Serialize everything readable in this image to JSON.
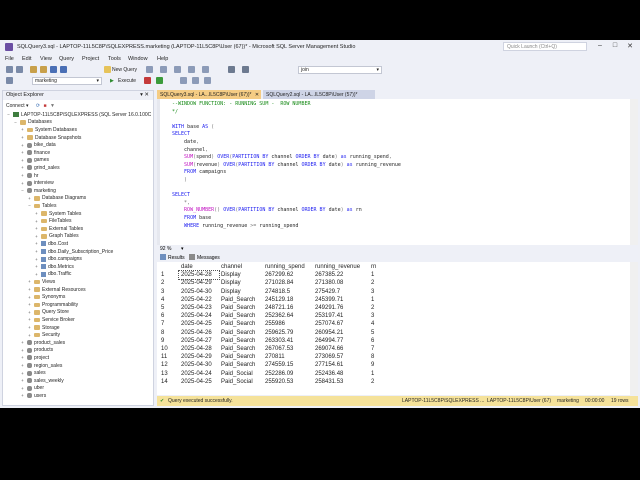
{
  "window": {
    "title": "SQLQuery3.sql - LAPTOP-11L5C8P\\SQLEXPRESS.marketing (LAPTOP-11L5C8P\\User (67))* - Microsoft SQL Server Management Studio",
    "quick_launch_placeholder": "Quick Launch (Ctrl+Q)"
  },
  "menu": [
    "File",
    "Edit",
    "View",
    "Query",
    "Project",
    "Tools",
    "Window",
    "Help"
  ],
  "toolbar": {
    "new_query": "New Query",
    "search_combo": "join",
    "database_combo": "marketing",
    "execute": "Execute"
  },
  "object_explorer": {
    "title": "Object Explorer",
    "connect": "Connect",
    "nodes": [
      {
        "label": "LAPTOP-11L5C8P\\SQLEXPRESS (SQL Server 16.0.100C",
        "level": 0,
        "exp": "−",
        "icon": "server"
      },
      {
        "label": "Databases",
        "level": 1,
        "exp": "−",
        "icon": "folder"
      },
      {
        "label": "System Databases",
        "level": 2,
        "exp": "+",
        "icon": "folder"
      },
      {
        "label": "Database Snapshots",
        "level": 2,
        "exp": "+",
        "icon": "folder"
      },
      {
        "label": "bike_data",
        "level": 2,
        "exp": "+",
        "icon": "db"
      },
      {
        "label": "finance",
        "level": 2,
        "exp": "+",
        "icon": "db"
      },
      {
        "label": "games",
        "level": 2,
        "exp": "+",
        "icon": "db"
      },
      {
        "label": "grind_sales",
        "level": 2,
        "exp": "+",
        "icon": "db"
      },
      {
        "label": "hr",
        "level": 2,
        "exp": "+",
        "icon": "db"
      },
      {
        "label": "interview",
        "level": 2,
        "exp": "+",
        "icon": "db"
      },
      {
        "label": "marketing",
        "level": 2,
        "exp": "−",
        "icon": "db"
      },
      {
        "label": "Database Diagrams",
        "level": 3,
        "exp": "+",
        "icon": "folder"
      },
      {
        "label": "Tables",
        "level": 3,
        "exp": "−",
        "icon": "folder"
      },
      {
        "label": "System Tables",
        "level": 4,
        "exp": "+",
        "icon": "folder"
      },
      {
        "label": "FileTables",
        "level": 4,
        "exp": "+",
        "icon": "folder"
      },
      {
        "label": "External Tables",
        "level": 4,
        "exp": "+",
        "icon": "folder"
      },
      {
        "label": "Graph Tables",
        "level": 4,
        "exp": "+",
        "icon": "folder"
      },
      {
        "label": "dbo.Cost",
        "level": 4,
        "exp": "+",
        "icon": "table"
      },
      {
        "label": "dbo.Daily_Subscription_Price",
        "level": 4,
        "exp": "+",
        "icon": "table"
      },
      {
        "label": "dbo.campaigns",
        "level": 4,
        "exp": "+",
        "icon": "table"
      },
      {
        "label": "dbo.Metrics",
        "level": 4,
        "exp": "+",
        "icon": "table"
      },
      {
        "label": "dbo.Traffic",
        "level": 4,
        "exp": "+",
        "icon": "table"
      },
      {
        "label": "Views",
        "level": 3,
        "exp": "+",
        "icon": "folder"
      },
      {
        "label": "External Resources",
        "level": 3,
        "exp": "+",
        "icon": "folder"
      },
      {
        "label": "Synonyms",
        "level": 3,
        "exp": "+",
        "icon": "folder"
      },
      {
        "label": "Programmability",
        "level": 3,
        "exp": "+",
        "icon": "folder"
      },
      {
        "label": "Query Store",
        "level": 3,
        "exp": "+",
        "icon": "folder"
      },
      {
        "label": "Service Broker",
        "level": 3,
        "exp": "+",
        "icon": "folder"
      },
      {
        "label": "Storage",
        "level": 3,
        "exp": "+",
        "icon": "folder"
      },
      {
        "label": "Security",
        "level": 3,
        "exp": "+",
        "icon": "folder"
      },
      {
        "label": "product_sales",
        "level": 2,
        "exp": "+",
        "icon": "db"
      },
      {
        "label": "products",
        "level": 2,
        "exp": "+",
        "icon": "db"
      },
      {
        "label": "project",
        "level": 2,
        "exp": "+",
        "icon": "db"
      },
      {
        "label": "region_sales",
        "level": 2,
        "exp": "+",
        "icon": "db"
      },
      {
        "label": "sales",
        "level": 2,
        "exp": "+",
        "icon": "db"
      },
      {
        "label": "sales_weekly",
        "level": 2,
        "exp": "+",
        "icon": "db"
      },
      {
        "label": "uber",
        "level": 2,
        "exp": "+",
        "icon": "db"
      },
      {
        "label": "users",
        "level": 2,
        "exp": "+",
        "icon": "db"
      }
    ]
  },
  "tabs": [
    {
      "label": "SQLQuery3.sql - LA...IL5C8P\\User (67))*",
      "active": true
    },
    {
      "label": "SQLQuery2.sql - LA...IL5C8P\\User (57))*",
      "active": false
    }
  ],
  "code_lines": [
    [
      {
        "t": "--WINDOW FUNCTION: - RUNNING SUM -  ROW NUMBER",
        "c": "cm"
      }
    ],
    [
      {
        "t": "*/",
        "c": "cm"
      }
    ],
    [
      {
        "t": "",
        "c": "tx"
      }
    ],
    [
      {
        "t": "WITH ",
        "c": "kw"
      },
      {
        "t": "base ",
        "c": "tx"
      },
      {
        "t": "AS ",
        "c": "kw"
      },
      {
        "t": "(",
        "c": "gr"
      }
    ],
    [
      {
        "t": "SELECT",
        "c": "kw"
      }
    ],
    [
      {
        "t": "    date",
        "c": "tx"
      },
      {
        "t": ",",
        "c": "gr"
      }
    ],
    [
      {
        "t": "    channel",
        "c": "tx"
      },
      {
        "t": ",",
        "c": "gr"
      }
    ],
    [
      {
        "t": "    ",
        "c": "tx"
      },
      {
        "t": "SUM",
        "c": "fn"
      },
      {
        "t": "(",
        "c": "gr"
      },
      {
        "t": "spend",
        "c": "tx"
      },
      {
        "t": ") ",
        "c": "gr"
      },
      {
        "t": "OVER",
        "c": "kw"
      },
      {
        "t": "(",
        "c": "gr"
      },
      {
        "t": "PARTITION BY ",
        "c": "kw"
      },
      {
        "t": "channel ",
        "c": "tx"
      },
      {
        "t": "ORDER BY ",
        "c": "kw"
      },
      {
        "t": "date",
        "c": "tx"
      },
      {
        "t": ") ",
        "c": "gr"
      },
      {
        "t": "as ",
        "c": "kw"
      },
      {
        "t": "running_spend",
        "c": "tx"
      },
      {
        "t": ",",
        "c": "gr"
      }
    ],
    [
      {
        "t": "    ",
        "c": "tx"
      },
      {
        "t": "SUM",
        "c": "fn"
      },
      {
        "t": "(",
        "c": "gr"
      },
      {
        "t": "revenue",
        "c": "tx"
      },
      {
        "t": ") ",
        "c": "gr"
      },
      {
        "t": "OVER",
        "c": "kw"
      },
      {
        "t": "(",
        "c": "gr"
      },
      {
        "t": "PARTITION BY ",
        "c": "kw"
      },
      {
        "t": "channel ",
        "c": "tx"
      },
      {
        "t": "ORDER BY ",
        "c": "kw"
      },
      {
        "t": "date",
        "c": "tx"
      },
      {
        "t": ") ",
        "c": "gr"
      },
      {
        "t": "as ",
        "c": "kw"
      },
      {
        "t": "running_revenue",
        "c": "tx"
      }
    ],
    [
      {
        "t": "    ",
        "c": "tx"
      },
      {
        "t": "FROM ",
        "c": "kw"
      },
      {
        "t": "campaigns",
        "c": "tx"
      }
    ],
    [
      {
        "t": "    )",
        "c": "gr"
      }
    ],
    [
      {
        "t": "",
        "c": "tx"
      }
    ],
    [
      {
        "t": "SELECT",
        "c": "kw"
      }
    ],
    [
      {
        "t": "    *",
        "c": "gr"
      },
      {
        "t": ",",
        "c": "gr"
      }
    ],
    [
      {
        "t": "    ",
        "c": "tx"
      },
      {
        "t": "ROW_NUMBER",
        "c": "fn"
      },
      {
        "t": "() ",
        "c": "gr"
      },
      {
        "t": "OVER",
        "c": "kw"
      },
      {
        "t": "(",
        "c": "gr"
      },
      {
        "t": "PARTITION BY ",
        "c": "kw"
      },
      {
        "t": "channel ",
        "c": "tx"
      },
      {
        "t": "ORDER BY ",
        "c": "kw"
      },
      {
        "t": "date",
        "c": "tx"
      },
      {
        "t": ") ",
        "c": "gr"
      },
      {
        "t": "as ",
        "c": "kw"
      },
      {
        "t": "rn",
        "c": "tx"
      }
    ],
    [
      {
        "t": "    ",
        "c": "tx"
      },
      {
        "t": "FROM ",
        "c": "kw"
      },
      {
        "t": "base",
        "c": "tx"
      }
    ],
    [
      {
        "t": "    ",
        "c": "tx"
      },
      {
        "t": "WHERE ",
        "c": "kw"
      },
      {
        "t": "running_revenue ",
        "c": "tx"
      },
      {
        "t": ">= ",
        "c": "gr"
      },
      {
        "t": "running_spend",
        "c": "tx"
      }
    ]
  ],
  "zoom_level": "92 %",
  "result_tabs": {
    "results": "Results",
    "messages": "Messages"
  },
  "results": {
    "columns": [
      "date",
      "channel",
      "running_spend",
      "running_revenue",
      "rn"
    ],
    "rows": [
      [
        "1",
        "2025-04-28",
        "Display",
        "267299.62",
        "267385.22",
        "1"
      ],
      [
        "2",
        "2025-04-29",
        "Display",
        "271028.84",
        "271380.08",
        "2"
      ],
      [
        "3",
        "2025-04-30",
        "Display",
        "274818.5",
        "275429.7",
        "3"
      ],
      [
        "4",
        "2025-04-22",
        "Paid_Search",
        "245129.18",
        "245399.71",
        "1"
      ],
      [
        "5",
        "2025-04-23",
        "Paid_Search",
        "248721.16",
        "249291.76",
        "2"
      ],
      [
        "6",
        "2025-04-24",
        "Paid_Search",
        "252362.64",
        "253197.41",
        "3"
      ],
      [
        "7",
        "2025-04-25",
        "Paid_Search",
        "255986",
        "257074.67",
        "4"
      ],
      [
        "8",
        "2025-04-26",
        "Paid_Search",
        "259625.79",
        "260954.21",
        "5"
      ],
      [
        "9",
        "2025-04-27",
        "Paid_Search",
        "263303.41",
        "264994.77",
        "6"
      ],
      [
        "10",
        "2025-04-28",
        "Paid_Search",
        "267067.53",
        "269074.66",
        "7"
      ],
      [
        "11",
        "2025-04-29",
        "Paid_Search",
        "270811",
        "273069.57",
        "8"
      ],
      [
        "12",
        "2025-04-30",
        "Paid_Search",
        "274559.15",
        "277154.61",
        "9"
      ],
      [
        "13",
        "2025-04-24",
        "Paid_Social",
        "252286.09",
        "252436.48",
        "1"
      ],
      [
        "14",
        "2025-04-25",
        "Paid_Social",
        "255920.53",
        "258431.53",
        "2"
      ]
    ]
  },
  "status": {
    "message": "Query executed successfully.",
    "server": "LAPTOP-11L5C8P\\SQLEXPRESS ...",
    "user": "LAPTOP-11L5C8P\\User (67)",
    "database": "marketing",
    "time": "00:00:00",
    "rows": "19 rows"
  },
  "colors": {
    "tab_active": "#f5cc84",
    "status_bar": "#f5e29a",
    "keyword": "#1d1df0",
    "function": "#c214c2",
    "comment": "#178a17"
  }
}
